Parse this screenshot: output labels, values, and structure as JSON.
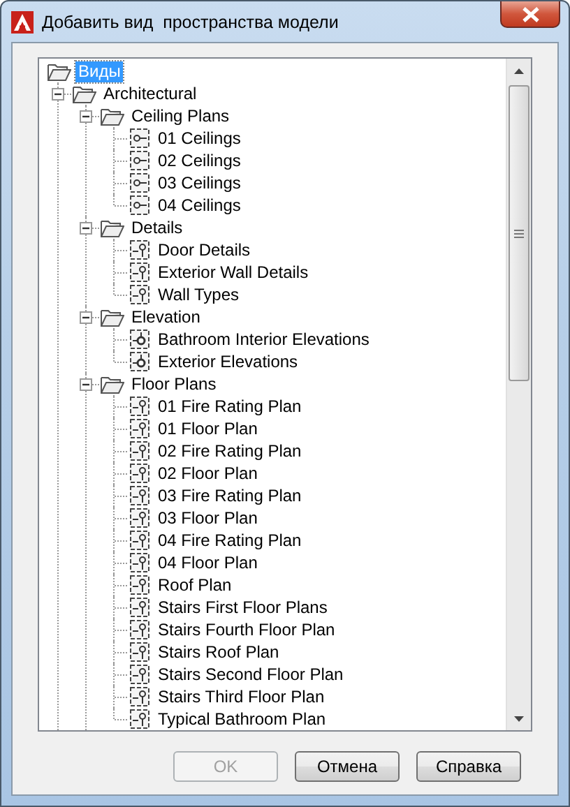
{
  "window": {
    "title": "Добавить вид  пространства модели"
  },
  "tree": {
    "label": "Виды",
    "selected": true,
    "children": [
      {
        "label": "Architectural",
        "kind": "folder",
        "expanded": true,
        "continues": true,
        "selected": false,
        "children": [
          {
            "label": "Ceiling Plans",
            "kind": "folder",
            "expanded": true,
            "selected": false,
            "children": [
              {
                "label": "01 Ceilings",
                "kind": "ceiling",
                "selected": false
              },
              {
                "label": "02 Ceilings",
                "kind": "ceiling",
                "selected": false
              },
              {
                "label": "03 Ceilings",
                "kind": "ceiling",
                "selected": false
              },
              {
                "label": "04 Ceilings",
                "kind": "ceiling",
                "selected": false
              }
            ]
          },
          {
            "label": "Details",
            "kind": "folder",
            "expanded": true,
            "selected": false,
            "children": [
              {
                "label": "Door Details",
                "kind": "detail",
                "selected": false
              },
              {
                "label": "Exterior Wall Details",
                "kind": "detail",
                "selected": false
              },
              {
                "label": "Wall Types",
                "kind": "detail",
                "selected": false
              }
            ]
          },
          {
            "label": "Elevation",
            "kind": "folder",
            "expanded": true,
            "selected": false,
            "children": [
              {
                "label": "Bathroom Interior Elevations",
                "kind": "elevation",
                "selected": false
              },
              {
                "label": "Exterior Elevations",
                "kind": "elevation",
                "selected": false
              }
            ]
          },
          {
            "label": "Floor Plans",
            "kind": "folder",
            "expanded": true,
            "continues": true,
            "selected": false,
            "children": [
              {
                "label": "01 Fire Rating Plan",
                "kind": "detail",
                "selected": false
              },
              {
                "label": "01 Floor Plan",
                "kind": "detail",
                "selected": false
              },
              {
                "label": "02 Fire Rating Plan",
                "kind": "detail",
                "selected": false
              },
              {
                "label": "02 Floor Plan",
                "kind": "detail",
                "selected": false
              },
              {
                "label": "03 Fire Rating Plan",
                "kind": "detail",
                "selected": false
              },
              {
                "label": "03 Floor Plan",
                "kind": "detail",
                "selected": false
              },
              {
                "label": "04 Fire Rating Plan",
                "kind": "detail",
                "selected": false
              },
              {
                "label": "04 Floor Plan",
                "kind": "detail",
                "selected": false
              },
              {
                "label": "Roof Plan",
                "kind": "detail",
                "selected": false
              },
              {
                "label": "Stairs First Floor Plans",
                "kind": "detail",
                "selected": false
              },
              {
                "label": "Stairs Fourth Floor Plan",
                "kind": "detail",
                "selected": false
              },
              {
                "label": "Stairs Roof Plan",
                "kind": "detail",
                "selected": false
              },
              {
                "label": "Stairs Second Floor Plan",
                "kind": "detail",
                "selected": false
              },
              {
                "label": "Stairs Third Floor Plan",
                "kind": "detail",
                "selected": false
              },
              {
                "label": "Typical Bathroom Plan",
                "kind": "detail",
                "selected": false
              }
            ]
          }
        ]
      }
    ]
  },
  "buttons": [
    {
      "label": "OK",
      "disabled": true
    },
    {
      "label": "Отмена",
      "disabled": false
    },
    {
      "label": "Справка",
      "disabled": false
    }
  ]
}
